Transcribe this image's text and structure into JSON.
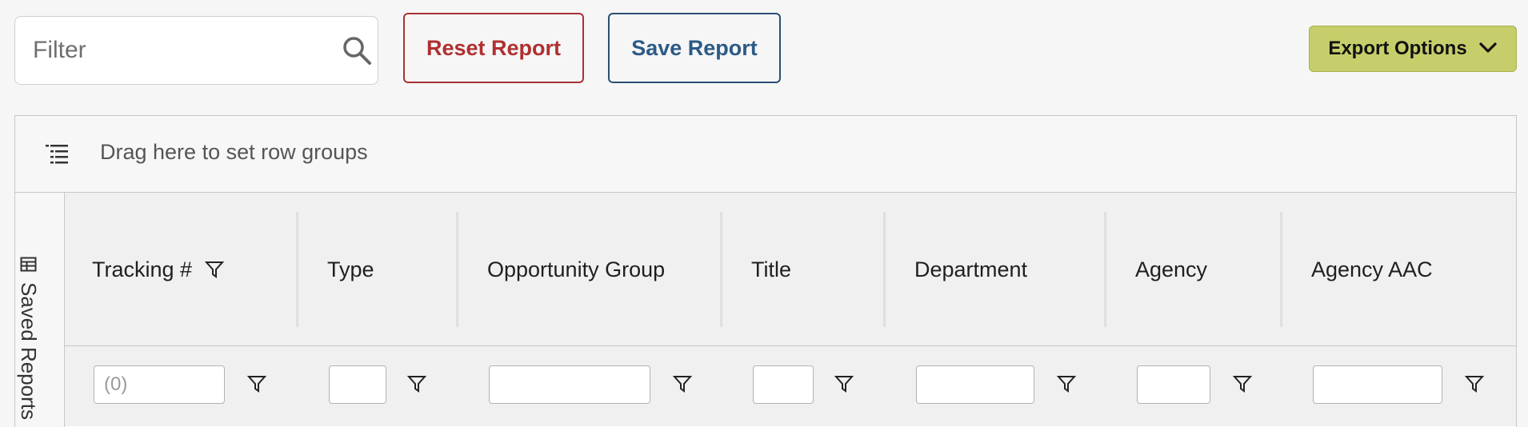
{
  "toolbar": {
    "filter_placeholder": "Filter",
    "reset_label": "Reset Report",
    "save_label": "Save Report",
    "export_label": "Export Options"
  },
  "grid": {
    "row_group_text": "Drag here to set row groups",
    "side_panel_label": "Saved Reports",
    "columns": [
      {
        "label": "Tracking #",
        "filter_value": "(0)",
        "filtered": true
      },
      {
        "label": "Type",
        "filter_value": ""
      },
      {
        "label": "Opportunity Group",
        "filter_value": ""
      },
      {
        "label": "Title",
        "filter_value": ""
      },
      {
        "label": "Department",
        "filter_value": ""
      },
      {
        "label": "Agency",
        "filter_value": ""
      },
      {
        "label": "Agency AAC",
        "filter_value": ""
      }
    ]
  },
  "colors": {
    "reset": "#b03030",
    "save": "#2b5a86",
    "export_bg": "#c6ce6b"
  }
}
